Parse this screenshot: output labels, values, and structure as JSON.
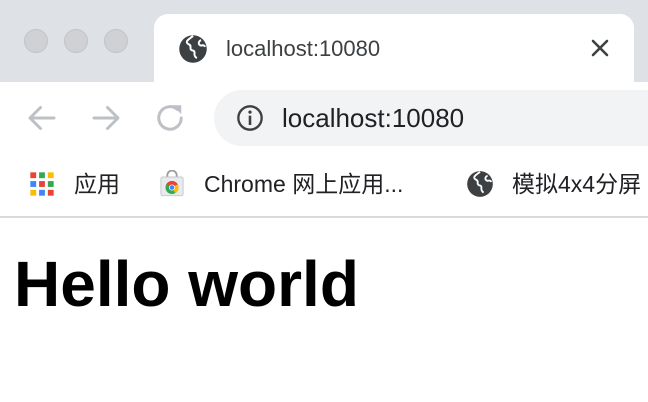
{
  "tab": {
    "title": "localhost:10080",
    "favicon": "globe-icon",
    "close_icon": "close-icon"
  },
  "toolbar": {
    "back_icon": "back-arrow-icon",
    "forward_icon": "forward-arrow-icon",
    "reload_icon": "reload-icon"
  },
  "omnibox": {
    "url": "localhost:10080",
    "info_icon": "info-icon"
  },
  "bookmarks": [
    {
      "label": "应用",
      "icon": "apps-grid-icon"
    },
    {
      "label": "Chrome 网上应用...",
      "icon": "chrome-web-store-icon"
    },
    {
      "label": "模拟4x4分屏",
      "icon": "globe-icon"
    }
  ],
  "page": {
    "heading": "Hello world"
  },
  "colors": {
    "tabstrip_bg": "#dee1e6",
    "omnibox_bg": "#f1f3f4",
    "icon_gray": "#5f6368",
    "disabled_gray": "#bdc1c6"
  }
}
